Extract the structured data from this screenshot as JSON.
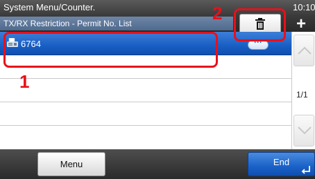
{
  "header": {
    "title": "System Menu/Counter.",
    "subtitle": "TX/RX Restriction - Permit No. List",
    "time": "10:10",
    "plus_label": "+"
  },
  "list": {
    "rows": [
      {
        "label": "6764",
        "selected": true,
        "icon": "fax-icon"
      },
      {
        "label": "",
        "selected": false
      },
      {
        "label": "",
        "selected": false
      },
      {
        "label": "",
        "selected": false
      },
      {
        "label": "",
        "selected": false
      }
    ],
    "detail_label": "···"
  },
  "scroll": {
    "page_indicator": "1/1"
  },
  "footer": {
    "menu_label": "Menu",
    "end_label": "End"
  },
  "annotations": {
    "one": "1",
    "two": "2"
  },
  "colors": {
    "selection_blue": "#1a5fc4",
    "annotation_red": "#e8101a",
    "header_dark": "#3a3a3a"
  }
}
